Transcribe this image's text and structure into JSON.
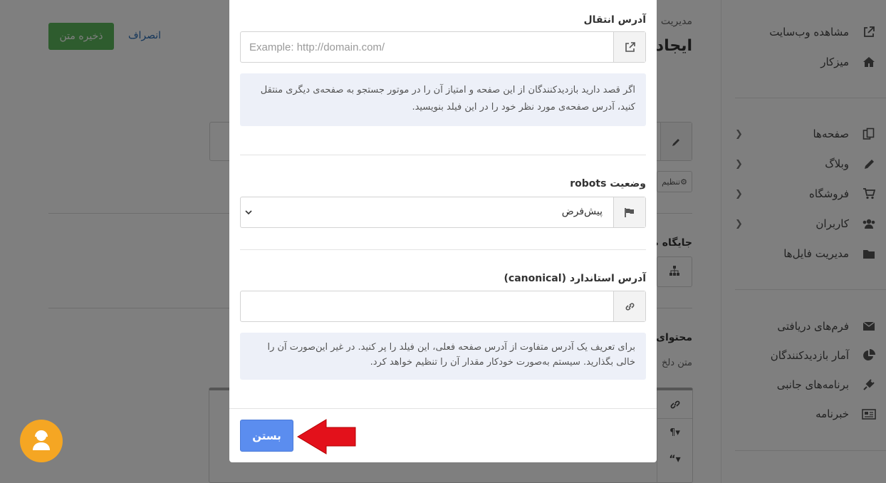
{
  "sidebar": {
    "items": [
      {
        "label": "مشاهده وب‌سایت",
        "icon": "external-link-icon",
        "has_chevron": false
      },
      {
        "label": "میزکار",
        "icon": "home-icon",
        "has_chevron": false
      },
      {
        "label": "صفحه‌ها",
        "icon": "pages-icon",
        "has_chevron": true
      },
      {
        "label": "وبلاگ",
        "icon": "pencil-icon",
        "has_chevron": true
      },
      {
        "label": "فروشگاه",
        "icon": "cart-icon",
        "has_chevron": true
      },
      {
        "label": "کاربران",
        "icon": "users-icon",
        "has_chevron": true
      },
      {
        "label": "مدیریت فایل‌ها",
        "icon": "folder-icon",
        "has_chevron": false
      },
      {
        "label": "فرم‌های دریافتی",
        "icon": "envelope-icon",
        "has_chevron": false
      },
      {
        "label": "آمار بازدیدکنندگان",
        "icon": "pie-chart-icon",
        "has_chevron": false
      },
      {
        "label": "برنامه‌های جانبی",
        "icon": "plug-icon",
        "has_chevron": false
      },
      {
        "label": "خبرنامه",
        "icon": "newspaper-icon",
        "has_chevron": false
      }
    ]
  },
  "header": {
    "save_label": "ذخیره متن",
    "cancel_label": "انصراف",
    "breadcrumb_fragment": "مدیریت",
    "title_fragment": "ایجاد",
    "settings_fragment": "تنظیم",
    "position_fragment": "جایگاه ص",
    "content_fragment": "محتوای",
    "content_sub_fragment": "متن دلخ"
  },
  "modal": {
    "redirect": {
      "label": "آدرس انتقال",
      "placeholder": "Example: http://domain.com/",
      "value": "",
      "help": "اگر قصد دارید بازدیدکنندگان از این صفحه و امتیاز آن را در موتور جستجو به صفحه‌ی دیگری منتقل کنید، آدرس صفحه‌ی مورد نظر خود را در این فیلد بنویسید."
    },
    "robots": {
      "label": "وضعیت robots",
      "selected": "پیش‌فرض"
    },
    "canonical": {
      "label": "آدرس استاندارد (canonical)",
      "value": "",
      "help": "برای تعریف یک آدرس متفاوت از آدرس صفحه فعلی، این فیلد را پر کنید. در غیر این‌صورت آن را خالی بگذارید. سیستم به‌صورت خودکار مقدار آن را تنظیم خواهد کرد."
    },
    "close_label": "بستن"
  },
  "colors": {
    "primary_button": "#5b8def",
    "save_button": "#5cb85c",
    "help_bg": "#edf0f8",
    "arrow": "#e3111b",
    "support": "#f5a623"
  }
}
